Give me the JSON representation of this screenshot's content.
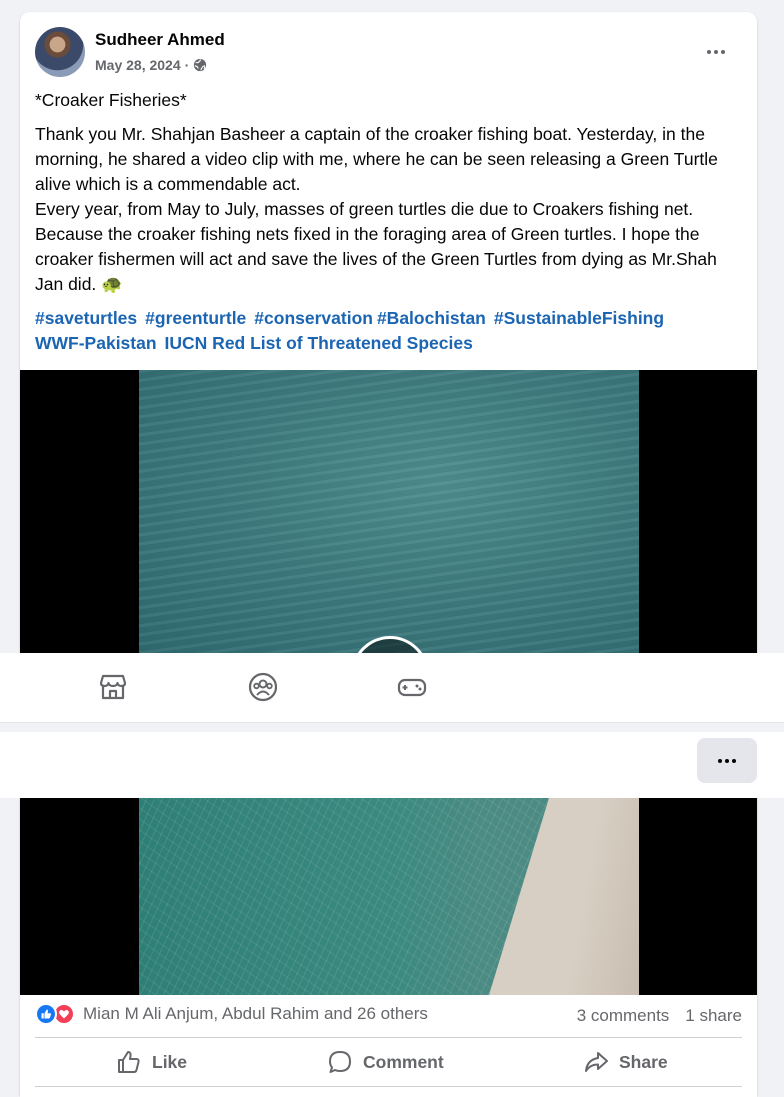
{
  "post": {
    "author": "Sudheer Ahmed",
    "date": "May 28, 2024",
    "separator": "·",
    "title_line": "*Croaker Fisheries*",
    "paragraph1": "Thank you Mr. Shahjan Basheer a captain of the croaker fishing boat. Yesterday, in the morning, he shared a video clip with me, where he can be seen releasing a Green Turtle alive which is a commendable act.",
    "paragraph2": "Every year, from May to July, masses of green turtles die due to Croakers fishing net. Because the croaker fishing nets fixed in the foraging area of Green turtles. I hope the croaker fishermen will act and save the lives of the Green Turtles from dying as Mr.Shah Jan did. 🐢",
    "hashtags": [
      "#saveturtles",
      "#greenturtle",
      "#conservation",
      "#Balochistan",
      "#SustainableFishing"
    ],
    "tags": [
      "WWF-Pakistan",
      "IUCN Red List of Threatened Species"
    ]
  },
  "navbar": {
    "icons": [
      "marketplace-icon",
      "groups-icon",
      "gaming-icon"
    ]
  },
  "engagement": {
    "reaction_names": "Mian M Ali Anjum, Abdul Rahim and 26 others",
    "comments": "3 comments",
    "shares": "1 share"
  },
  "actions": {
    "like": "Like",
    "comment": "Comment",
    "share": "Share"
  },
  "colors": {
    "link": "#1b65b3",
    "like_blue": "#1877f2",
    "love_red": "#f33e58",
    "secondary_text": "#65676b"
  }
}
